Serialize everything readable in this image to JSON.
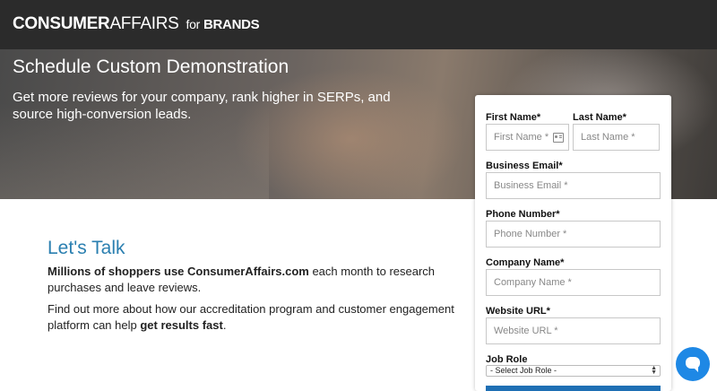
{
  "header": {
    "logo_part1": "CONSUMER",
    "logo_part2": "AFFAIRS",
    "logo_for": "for",
    "logo_brands": "BRANDS"
  },
  "hero": {
    "title": "Schedule Custom Demonstration",
    "subtitle": "Get more reviews for your company, rank higher in SERPs, and source high-conversion leads."
  },
  "main": {
    "heading": "Let's Talk",
    "p1_bold": "Millions of shoppers use ConsumerAffairs.com",
    "p1_rest": " each month to research purchases and leave reviews.",
    "p2_rest": "Find out more about how our accreditation program and customer engagement platform can help ",
    "p2_bold": "get results fast",
    "p2_end": "."
  },
  "form": {
    "first_name_label": "First Name*",
    "first_name_placeholder": "First Name *",
    "last_name_label": "Last Name*",
    "last_name_placeholder": "Last Name *",
    "email_label": "Business Email*",
    "email_placeholder": "Business Email *",
    "phone_label": "Phone Number*",
    "phone_placeholder": "Phone Number *",
    "company_label": "Company Name*",
    "company_placeholder": "Company Name *",
    "website_label": "Website URL*",
    "website_placeholder": "Website URL *",
    "job_role_label": "Job Role",
    "job_role_selected": "- Select Job Role -",
    "contact_icon": "contact-card-icon"
  },
  "chat": {
    "icon": "chat-bubble-icon",
    "color": "#1e88e5"
  },
  "colors": {
    "accent": "#2a7fb0",
    "header_bg": "#2b2b2b",
    "submit": "#1e6fb4"
  }
}
